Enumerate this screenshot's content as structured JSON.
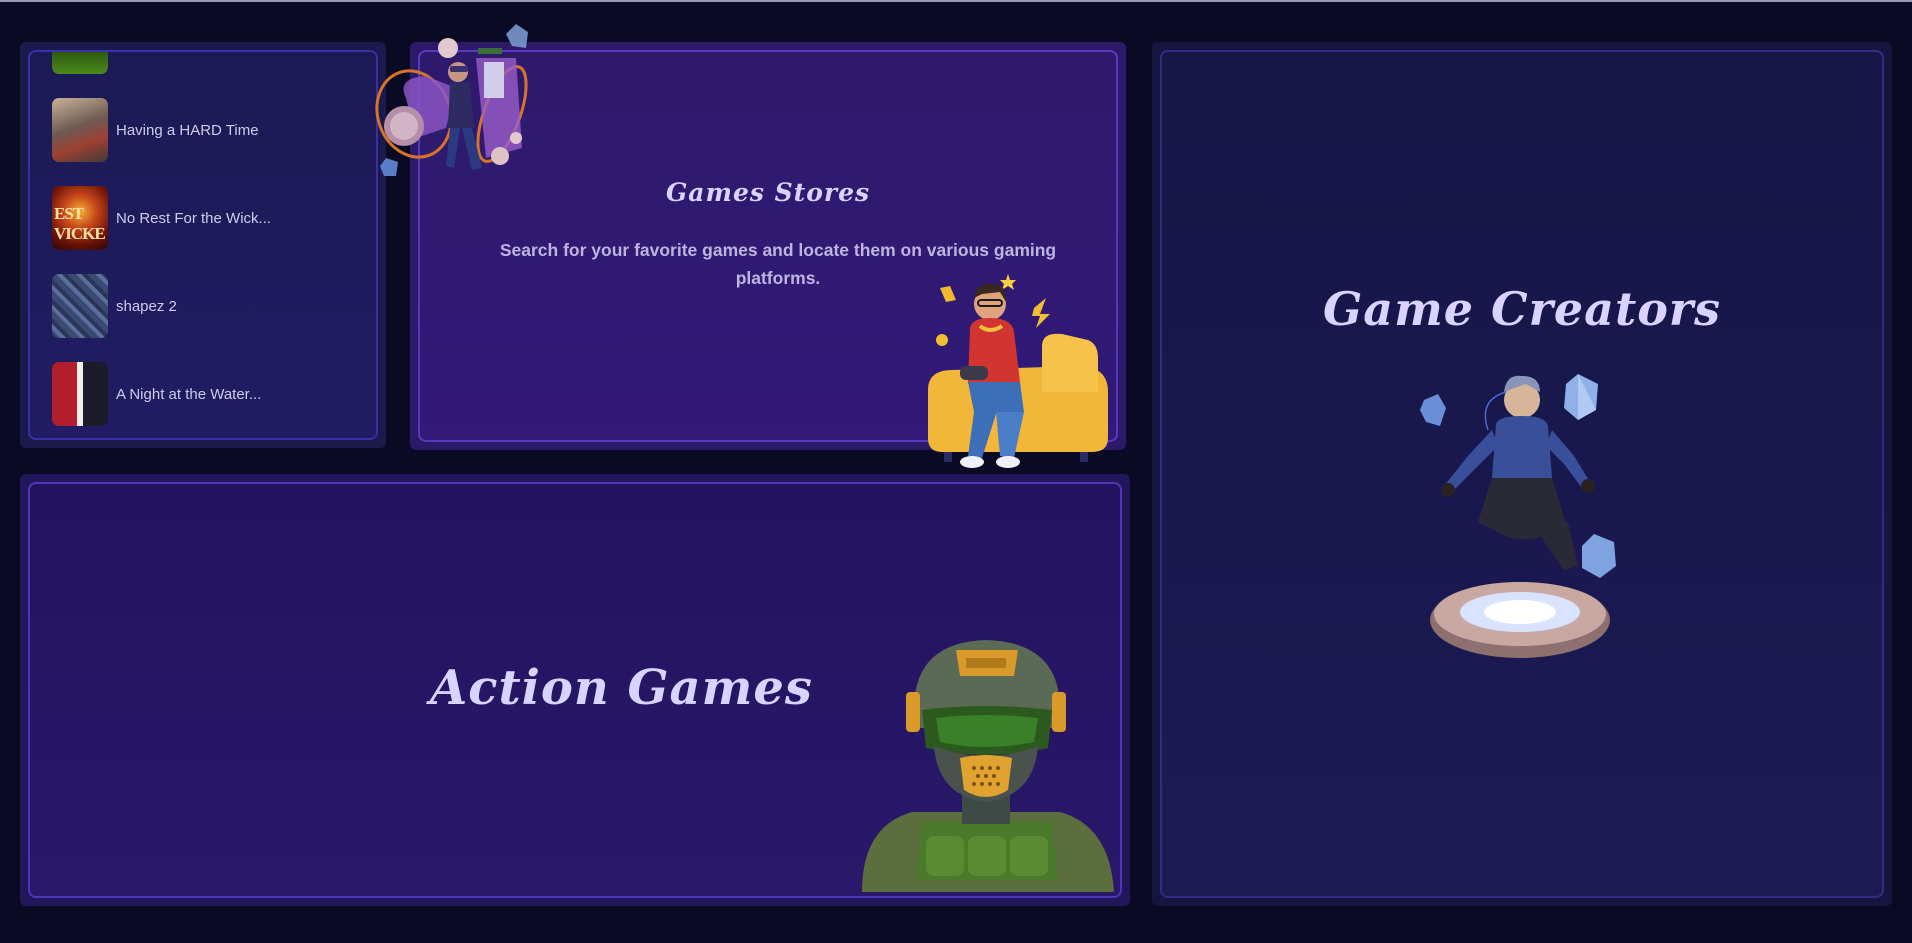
{
  "games_list": {
    "items": [
      {
        "label": ""
      },
      {
        "label": "Having a HARD Time"
      },
      {
        "label": "No Rest For the Wick..."
      },
      {
        "label": "shapez 2"
      },
      {
        "label": "A Night at the Water..."
      }
    ],
    "thumb_glyph": "EST VICKE"
  },
  "stores": {
    "title": "Games Stores",
    "description": "Search for your favorite games and locate them on various gaming platforms."
  },
  "action": {
    "title": "Action Games"
  },
  "creators": {
    "title": "Game Creators"
  },
  "colors": {
    "background": "#0b0a24",
    "card_purple": "#2d1a6b",
    "border_accent": "#5838c0",
    "title_text": "#d8d3ff"
  },
  "icons": [
    "gamer-on-couch-illustration",
    "vr-player-illustration",
    "soldier-helmet-illustration",
    "floating-avatar-illustration"
  ]
}
